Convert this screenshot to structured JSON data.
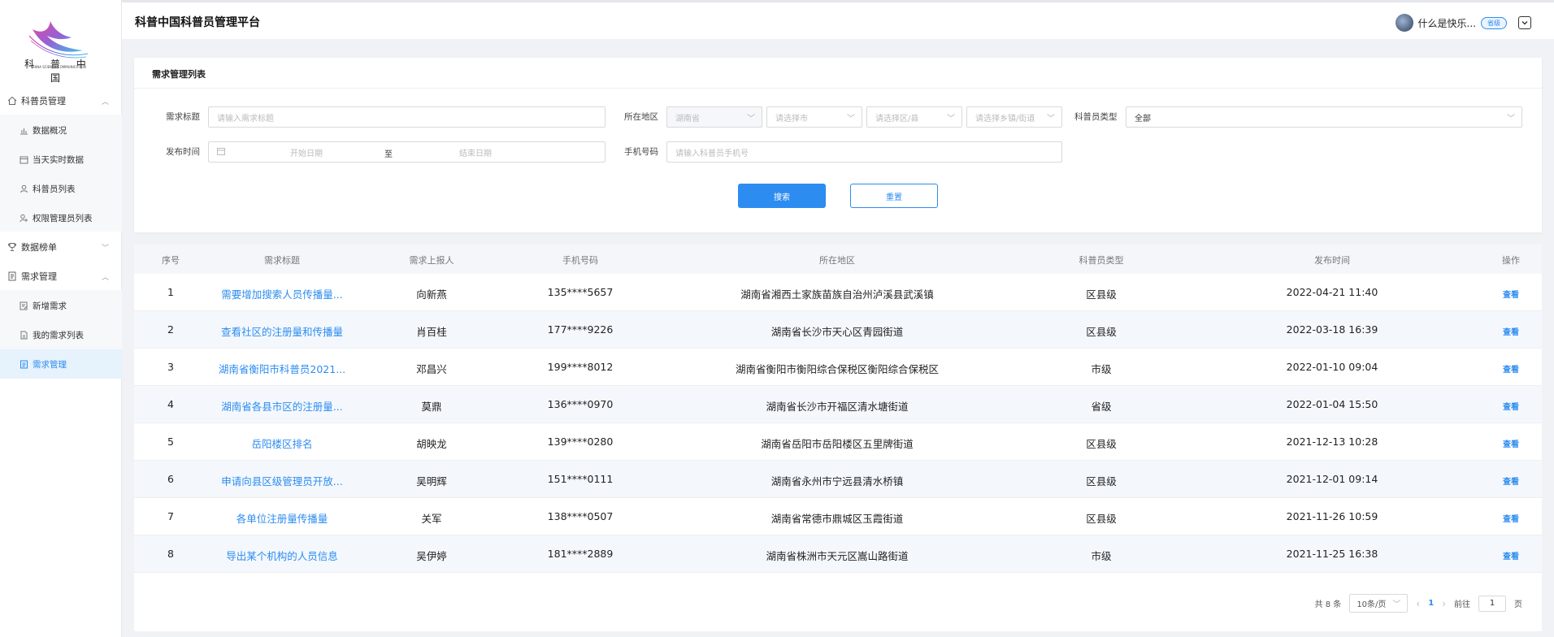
{
  "header": {
    "title": "科普中国科普员管理平台",
    "user_name": "什么是快乐...",
    "role_badge": "省级"
  },
  "logo": {
    "text": "科 普 中 国",
    "sub": "CHINA SCIENCE COMMUNICATION"
  },
  "sidebar": {
    "groups": [
      {
        "label": "科普员管理",
        "icon": "home-icon",
        "expanded": true,
        "items": [
          {
            "label": "数据概况",
            "icon": "bar-chart-icon"
          },
          {
            "label": "当天实时数据",
            "icon": "calendar-icon"
          },
          {
            "label": "科普员列表",
            "icon": "user-icon"
          },
          {
            "label": "权限管理员列表",
            "icon": "user-key-icon"
          }
        ]
      },
      {
        "label": "数据榜单",
        "icon": "trophy-icon",
        "expanded": false,
        "items": []
      },
      {
        "label": "需求管理",
        "icon": "document-icon",
        "expanded": true,
        "items": [
          {
            "label": "新增需求",
            "icon": "edit-icon"
          },
          {
            "label": "我的需求列表",
            "icon": "file-icon"
          },
          {
            "label": "需求管理",
            "icon": "list-icon",
            "active": true
          }
        ]
      }
    ]
  },
  "search": {
    "card_title": "需求管理列表",
    "title_label": "需求标题",
    "title_placeholder": "请输入需求标题",
    "region_label": "所在地区",
    "province_value": "湖南省",
    "city_placeholder": "请选择市",
    "district_placeholder": "请选择区/县",
    "town_placeholder": "请选择乡镇/街道",
    "type_label": "科普员类型",
    "type_value": "全部",
    "date_label": "发布时间",
    "start_placeholder": "开始日期",
    "date_sep": "至",
    "end_placeholder": "结束日期",
    "phone_label": "手机号码",
    "phone_placeholder": "请输入科普员手机号",
    "search_button": "搜索",
    "reset_button": "重置"
  },
  "table": {
    "columns": [
      "序号",
      "需求标题",
      "需求上报人",
      "手机号码",
      "所在地区",
      "科普员类型",
      "发布时间",
      "操作"
    ],
    "rows": [
      {
        "no": "1",
        "title": "需要增加搜索人员传播量...",
        "reporter": "向新燕",
        "phone": "135****5657",
        "region": "湖南省湘西土家族苗族自治州泸溪县武溪镇",
        "type": "区县级",
        "time": "2022-04-21 11:40",
        "op": "查看"
      },
      {
        "no": "2",
        "title": "查看社区的注册量和传播量",
        "reporter": "肖百桂",
        "phone": "177****9226",
        "region": "湖南省长沙市天心区青园街道",
        "type": "区县级",
        "time": "2022-03-18 16:39",
        "op": "查看"
      },
      {
        "no": "3",
        "title": "湖南省衡阳市科普员2021...",
        "reporter": "邓昌兴",
        "phone": "199****8012",
        "region": "湖南省衡阳市衡阳综合保税区衡阳综合保税区",
        "type": "市级",
        "time": "2022-01-10 09:04",
        "op": "查看"
      },
      {
        "no": "4",
        "title": "湖南省各县市区的注册量...",
        "reporter": "莫鼎",
        "phone": "136****0970",
        "region": "湖南省长沙市开福区清水塘街道",
        "type": "省级",
        "time": "2022-01-04 15:50",
        "op": "查看"
      },
      {
        "no": "5",
        "title": "岳阳楼区排名",
        "reporter": "胡映龙",
        "phone": "139****0280",
        "region": "湖南省岳阳市岳阳楼区五里牌街道",
        "type": "区县级",
        "time": "2021-12-13 10:28",
        "op": "查看"
      },
      {
        "no": "6",
        "title": "申请向县区级管理员开放...",
        "reporter": "吴明辉",
        "phone": "151****0111",
        "region": "湖南省永州市宁远县清水桥镇",
        "type": "区县级",
        "time": "2021-12-01 09:14",
        "op": "查看"
      },
      {
        "no": "7",
        "title": "各单位注册量传播量",
        "reporter": "关军",
        "phone": "138****0507",
        "region": "湖南省常德市鼎城区玉霞街道",
        "type": "区县级",
        "time": "2021-11-26 10:59",
        "op": "查看"
      },
      {
        "no": "8",
        "title": "导出某个机构的人员信息",
        "reporter": "吴伊婷",
        "phone": "181****2889",
        "region": "湖南省株洲市天元区嵩山路街道",
        "type": "市级",
        "time": "2021-11-25 16:38",
        "op": "查看"
      }
    ]
  },
  "pagination": {
    "total": "共 8 条",
    "page_size": "10条/页",
    "current_page": "1",
    "goto_label": "前往",
    "goto_value": "1",
    "page_suffix": "页"
  },
  "colors": {
    "accent": "#2d8cf0",
    "row_alt": "#f4f8fd",
    "page_bg": "#f0f2f5"
  }
}
